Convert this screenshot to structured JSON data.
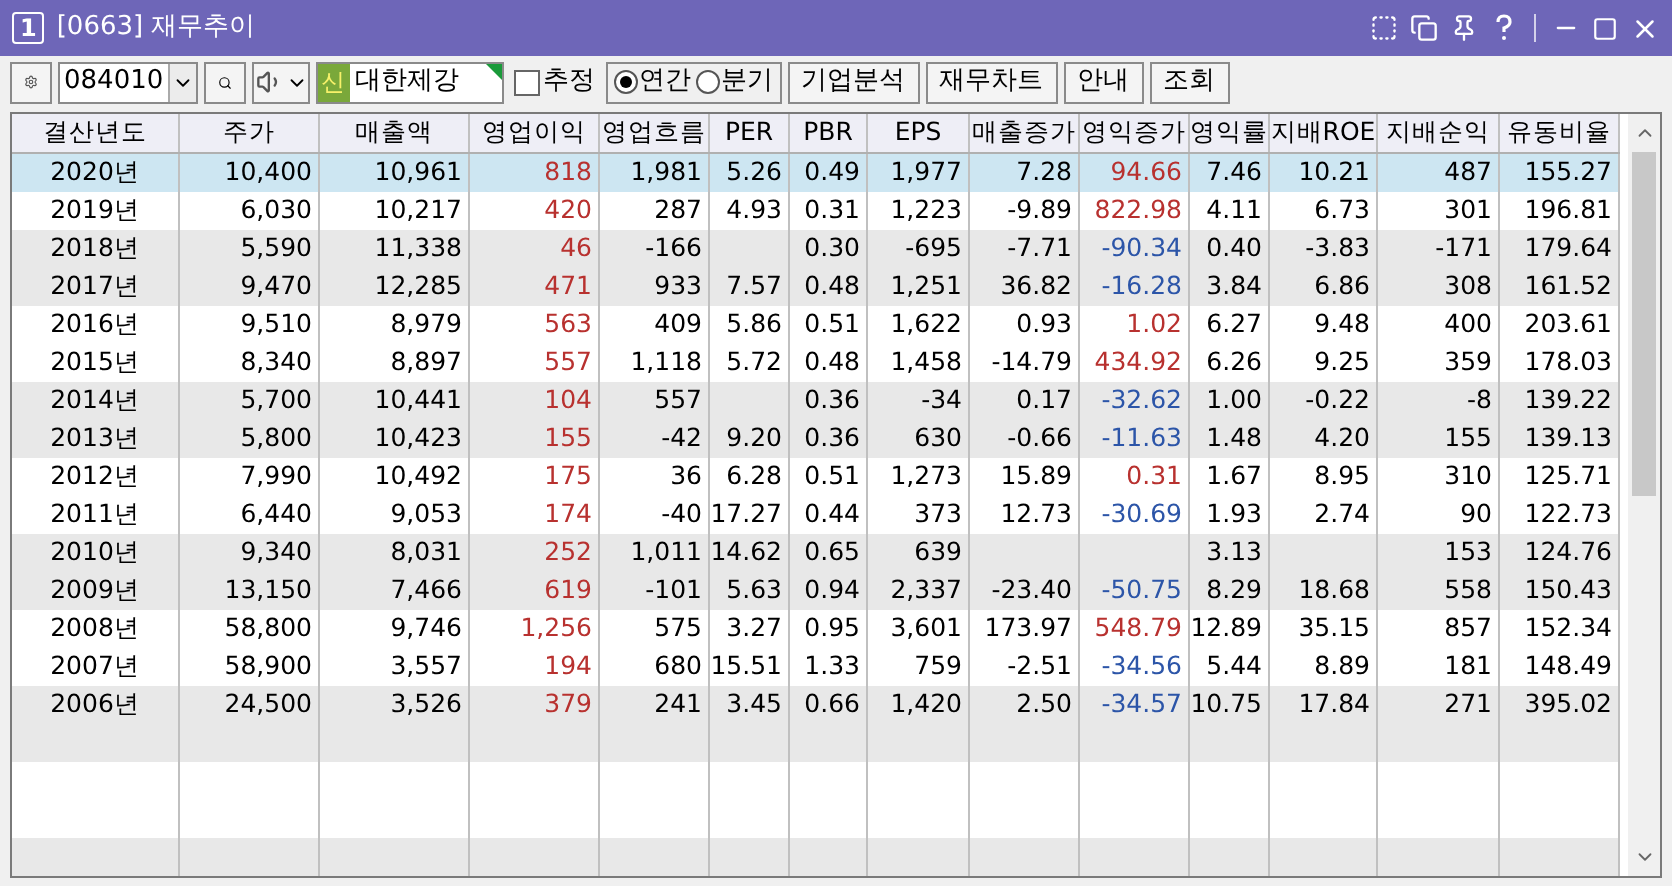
{
  "window": {
    "badge": "1",
    "title": "[0663] 재무추이"
  },
  "toolbar": {
    "code": "084010",
    "market_badge": "신",
    "company": "대한제강",
    "estimate": {
      "label": "추정",
      "checked": false
    },
    "periods": [
      {
        "label": "연간",
        "selected": true
      },
      {
        "label": "분기",
        "selected": false
      }
    ],
    "buttons": [
      "기업분석",
      "재무차트",
      "안내",
      "조회"
    ]
  },
  "table": {
    "columns": [
      "결산년도",
      "주가",
      "매출액",
      "영업이익",
      "영업흐름",
      "PER",
      "PBR",
      "EPS",
      "매출증가",
      "영익증가",
      "영익률",
      "지배ROE",
      "지배순익",
      "유동비율"
    ],
    "rows": [
      {
        "selected": true,
        "cells": [
          "2020년",
          "10,400",
          "10,961",
          {
            "text": "818",
            "color": "#b8312f"
          },
          "1,981",
          "5.26",
          "0.49",
          "1,977",
          "7.28",
          {
            "text": "94.66",
            "color": "#b8312f"
          },
          "7.46",
          "10.21",
          "487",
          "155.27"
        ]
      },
      {
        "selected": false,
        "cells": [
          "2019년",
          "6,030",
          "10,217",
          {
            "text": "420",
            "color": "#b8312f"
          },
          "287",
          "4.93",
          "0.31",
          "1,223",
          "-9.89",
          {
            "text": "822.98",
            "color": "#b8312f"
          },
          "4.11",
          "6.73",
          "301",
          "196.81"
        ]
      },
      {
        "selected": false,
        "cells": [
          "2018년",
          "5,590",
          "11,338",
          {
            "text": "46",
            "color": "#b8312f"
          },
          "-166",
          null,
          "0.30",
          "-695",
          "-7.71",
          {
            "text": "-90.34",
            "color": "#2c55a8"
          },
          "0.40",
          "-3.83",
          "-171",
          "179.64"
        ]
      },
      {
        "selected": false,
        "cells": [
          "2017년",
          "9,470",
          "12,285",
          {
            "text": "471",
            "color": "#b8312f"
          },
          "933",
          "7.57",
          "0.48",
          "1,251",
          "36.82",
          {
            "text": "-16.28",
            "color": "#2c55a8"
          },
          "3.84",
          "6.86",
          "308",
          "161.52"
        ]
      },
      {
        "selected": false,
        "cells": [
          "2016년",
          "9,510",
          "8,979",
          {
            "text": "563",
            "color": "#b8312f"
          },
          "409",
          "5.86",
          "0.51",
          "1,622",
          "0.93",
          {
            "text": "1.02",
            "color": "#b8312f"
          },
          "6.27",
          "9.48",
          "400",
          "203.61"
        ]
      },
      {
        "selected": false,
        "cells": [
          "2015년",
          "8,340",
          "8,897",
          {
            "text": "557",
            "color": "#b8312f"
          },
          "1,118",
          "5.72",
          "0.48",
          "1,458",
          "-14.79",
          {
            "text": "434.92",
            "color": "#b8312f"
          },
          "6.26",
          "9.25",
          "359",
          "178.03"
        ]
      },
      {
        "selected": false,
        "cells": [
          "2014년",
          "5,700",
          "10,441",
          {
            "text": "104",
            "color": "#b8312f"
          },
          "557",
          null,
          "0.36",
          "-34",
          "0.17",
          {
            "text": "-32.62",
            "color": "#2c55a8"
          },
          "1.00",
          "-0.22",
          "-8",
          "139.22"
        ]
      },
      {
        "selected": false,
        "cells": [
          "2013년",
          "5,800",
          "10,423",
          {
            "text": "155",
            "color": "#b8312f"
          },
          "-42",
          "9.20",
          "0.36",
          "630",
          "-0.66",
          {
            "text": "-11.63",
            "color": "#2c55a8"
          },
          "1.48",
          "4.20",
          "155",
          "139.13"
        ]
      },
      {
        "selected": false,
        "cells": [
          "2012년",
          "7,990",
          "10,492",
          {
            "text": "175",
            "color": "#b8312f"
          },
          "36",
          "6.28",
          "0.51",
          "1,273",
          "15.89",
          {
            "text": "0.31",
            "color": "#b8312f"
          },
          "1.67",
          "8.95",
          "310",
          "125.71"
        ]
      },
      {
        "selected": false,
        "cells": [
          "2011년",
          "6,440",
          "9,053",
          {
            "text": "174",
            "color": "#b8312f"
          },
          "-40",
          "17.27",
          "0.44",
          "373",
          "12.73",
          {
            "text": "-30.69",
            "color": "#2c55a8"
          },
          "1.93",
          "2.74",
          "90",
          "122.73"
        ]
      },
      {
        "selected": false,
        "cells": [
          "2010년",
          "9,340",
          "8,031",
          {
            "text": "252",
            "color": "#b8312f"
          },
          "1,011",
          "14.62",
          "0.65",
          "639",
          null,
          null,
          "3.13",
          null,
          "153",
          "124.76"
        ]
      },
      {
        "selected": false,
        "cells": [
          "2009년",
          "13,150",
          "7,466",
          {
            "text": "619",
            "color": "#b8312f"
          },
          "-101",
          "5.63",
          "0.94",
          "2,337",
          "-23.40",
          {
            "text": "-50.75",
            "color": "#2c55a8"
          },
          "8.29",
          "18.68",
          "558",
          "150.43"
        ]
      },
      {
        "selected": false,
        "cells": [
          "2008년",
          "58,800",
          "9,746",
          {
            "text": "1,256",
            "color": "#b8312f"
          },
          "575",
          "3.27",
          "0.95",
          "3,601",
          "173.97",
          {
            "text": "548.79",
            "color": "#b8312f"
          },
          "12.89",
          "35.15",
          "857",
          "152.34"
        ]
      },
      {
        "selected": false,
        "cells": [
          "2007년",
          "58,900",
          "3,557",
          {
            "text": "194",
            "color": "#b8312f"
          },
          "680",
          "15.51",
          "1.33",
          "759",
          "-2.51",
          {
            "text": "-34.56",
            "color": "#2c55a8"
          },
          "5.44",
          "8.89",
          "181",
          "148.49"
        ]
      },
      {
        "selected": false,
        "cells": [
          "2006년",
          "24,500",
          "3,526",
          {
            "text": "379",
            "color": "#b8312f"
          },
          "241",
          "3.45",
          "0.66",
          "1,420",
          "2.50",
          {
            "text": "-34.57",
            "color": "#2c55a8"
          },
          "10.75",
          "17.84",
          "271",
          "395.02"
        ]
      }
    ]
  }
}
